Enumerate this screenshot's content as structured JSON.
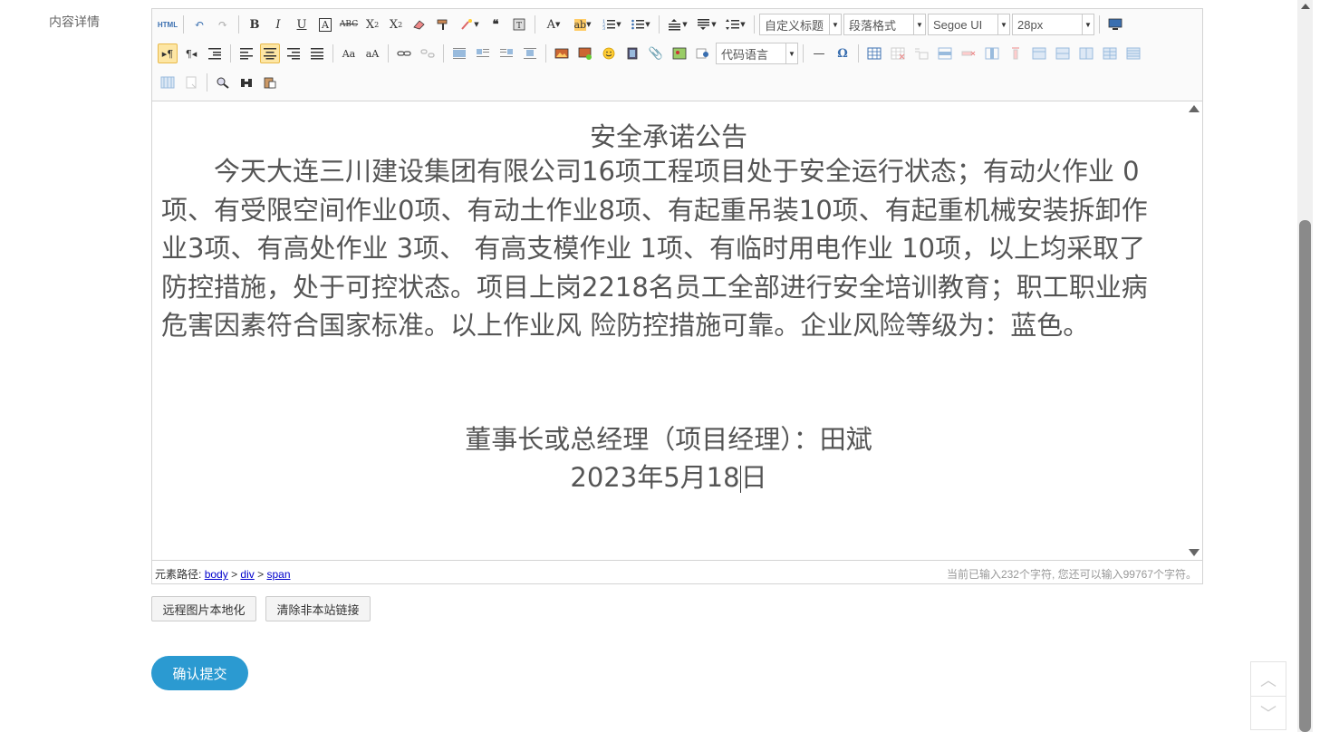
{
  "form": {
    "content_label": "内容详情"
  },
  "toolbar": {
    "html_label": "HTML",
    "custom_heading": "自定义标题",
    "paragraph_format": "段落格式",
    "font_family": "Segoe UI",
    "font_size": "28px",
    "code_language": "代码语言"
  },
  "doc": {
    "title": "安全承诺公告",
    "body": "今天大连三川建设集团有限公司16项工程项目处于安全运行状态；有动火作业 0项、有受限空间作业0项、有动土作业8项、有起重吊装10项、有起重机械安装拆卸作业3项、有高处作业 3项、 有高支模作业 1项、有临时用电作业 10项，以上均采取了防控措施，处于可控状态。项目上岗2218名员工全部进行安全培训教育；职工职业病危害因素符合国家标准。以上作业风 险防控措施可靠。企业风险等级为：蓝色。",
    "signature": "董事长或总经理（项目经理）：田斌",
    "date_before_caret": "2023年5月18",
    "date_after_caret": "日"
  },
  "status": {
    "path_label": "元素路径:",
    "path": [
      "body",
      "div",
      "span"
    ],
    "path_sep": ">",
    "char_count": "当前已输入232个字符, 您还可以输入99767个字符。"
  },
  "actions": {
    "localize_images": "远程图片本地化",
    "clear_external_links": "清除非本站链接",
    "submit": "确认提交"
  },
  "colors": {
    "accent": "#2b9ad1",
    "active_tool": "#fde6a4"
  }
}
